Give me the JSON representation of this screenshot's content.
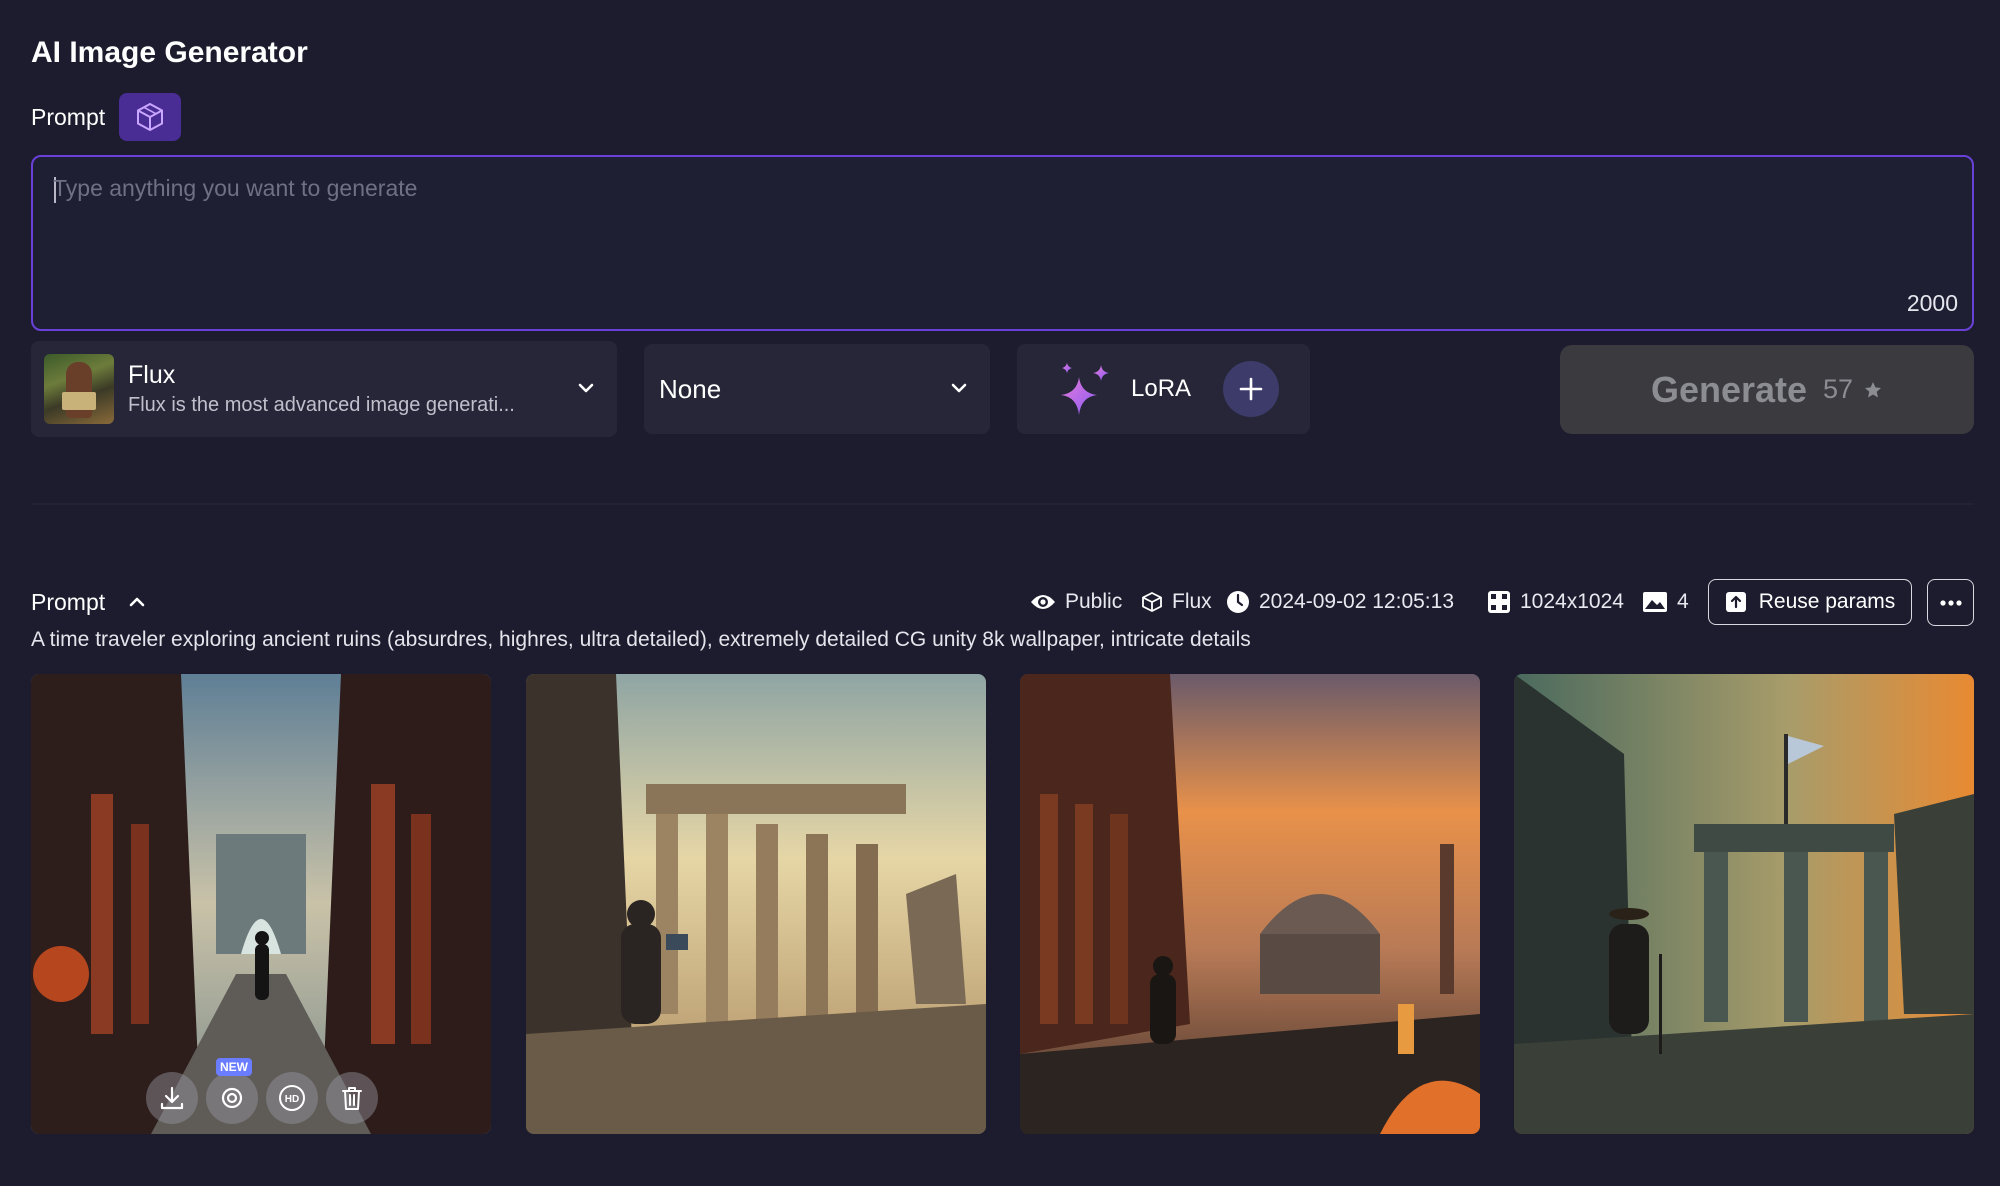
{
  "page": {
    "title": "AI Image Generator"
  },
  "prompt_section": {
    "label": "Prompt",
    "placeholder": "Type anything you want to generate",
    "value": "",
    "char_limit": "2000"
  },
  "model": {
    "name": "Flux",
    "description": "Flux is the most advanced image generati..."
  },
  "style_select": {
    "value": "None"
  },
  "lora": {
    "label": "LoRA"
  },
  "generate": {
    "label": "Generate",
    "count": "57"
  },
  "history": {
    "label": "Prompt",
    "visibility": "Public",
    "model": "Flux",
    "timestamp": "2024-09-02 12:05:13",
    "resolution": "1024x1024",
    "image_count": "4",
    "reuse_label": "Reuse params",
    "prompt_text": "A time traveler exploring ancient ruins (absurdres, highres, ultra detailed), extremely detailed CG unity 8k wallpaper, intricate details",
    "badge_new": "NEW",
    "images": [
      "time traveler in ruins corridor",
      "traveler with tablet among columns",
      "traveler at sunset ruins with fire",
      "traveler with cane under ruined arch"
    ]
  },
  "colors": {
    "background": "#1c1c2e",
    "accent": "#6941d8",
    "panel": "#262638",
    "generate_disabled": "#3a3a3f"
  }
}
